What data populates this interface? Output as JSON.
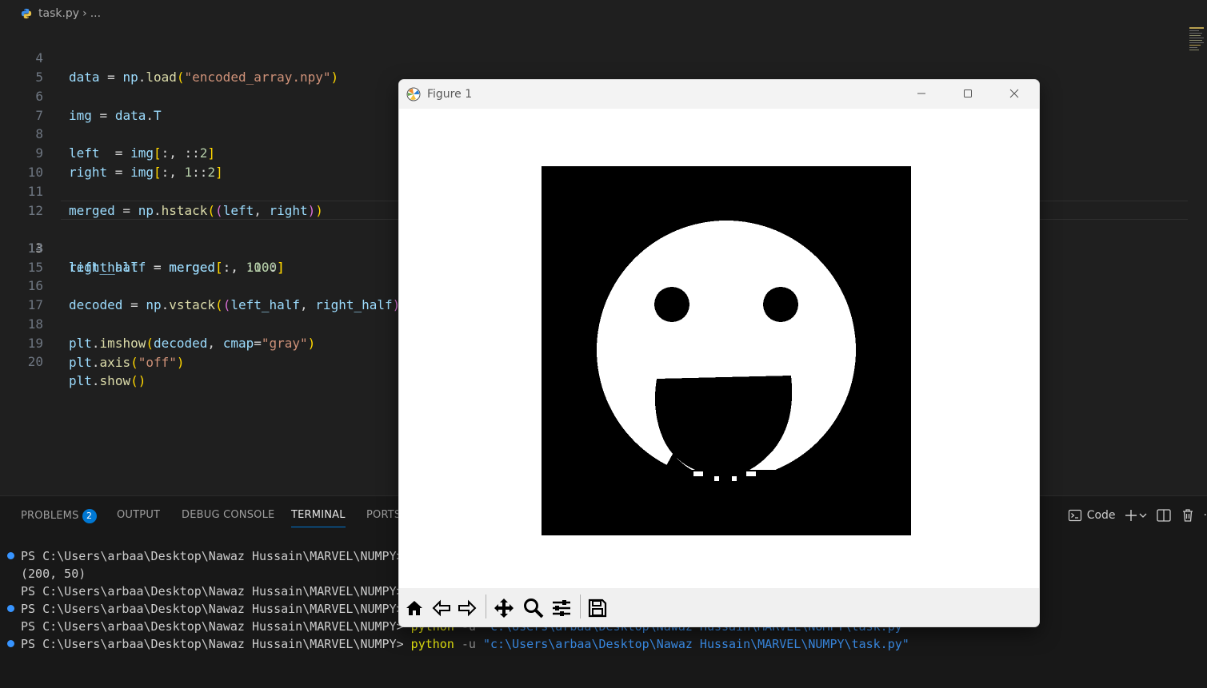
{
  "breadcrumb": {
    "file": "task.py",
    "more": "..."
  },
  "editor": {
    "active_line": "13",
    "lines": [
      {
        "n": "4",
        "t": "data = np.load(\"encoded_array.npy\")"
      },
      {
        "n": "5",
        "t": ""
      },
      {
        "n": "6",
        "t": "img = data.T"
      },
      {
        "n": "7",
        "t": ""
      },
      {
        "n": "8",
        "t": "left  = img[:, ::2]"
      },
      {
        "n": "9",
        "t": "right = img[:, 1::2]"
      },
      {
        "n": "10",
        "t": ""
      },
      {
        "n": "11",
        "t": "merged = np.hstack((left, right))"
      },
      {
        "n": "12",
        "t": ""
      },
      {
        "n": "13",
        "t": "left_half  = merged[:, :100]"
      },
      {
        "n": "14",
        "t": "right_half = merged[:, 100:]"
      },
      {
        "n": "15",
        "t": ""
      },
      {
        "n": "16",
        "t": "decoded = np.vstack((left_half, right_half)"
      },
      {
        "n": "17",
        "t": ""
      },
      {
        "n": "18",
        "t": "plt.imshow(decoded, cmap=\"gray\")"
      },
      {
        "n": "19",
        "t": "plt.axis(\"off\")"
      },
      {
        "n": "20",
        "t": "plt.show()"
      }
    ]
  },
  "panel": {
    "tabs": {
      "problems": "PROBLEMS",
      "problems_count": "2",
      "output": "OUTPUT",
      "debug": "DEBUG CONSOLE",
      "terminal": "TERMINAL",
      "ports": "PORTS"
    },
    "profile_label": "Code",
    "terminal": {
      "l1": "PS C:\\Users\\arbaa\\Desktop\\Nawaz Hussain\\MARVEL\\NUMPY>",
      "l2": "(200, 50)",
      "l3": "PS C:\\Users\\arbaa\\Desktop\\Nawaz Hussain\\MARVEL\\NUMPY>",
      "l4": "PS C:\\Users\\arbaa\\Desktop\\Nawaz Hussain\\MARVEL\\NUMPY>",
      "l5_prompt": "PS C:\\Users\\arbaa\\Desktop\\Nawaz Hussain\\MARVEL\\NUMPY>",
      "l5_cmd": "python",
      "l5_flag": "-u",
      "l5_path": "\"c:\\Users\\arbaa\\Desktop\\Nawaz Hussain\\MARVEL\\NUMPY\\task.py\"",
      "l6_prompt": "PS C:\\Users\\arbaa\\Desktop\\Nawaz Hussain\\MARVEL\\NUMPY>",
      "l6_cmd": "python",
      "l6_flag": "-u",
      "l6_path": "\"c:\\Users\\arbaa\\Desktop\\Nawaz Hussain\\MARVEL\\NUMPY\\task.py\""
    }
  },
  "figure": {
    "title": "Figure 1",
    "toolbar_icons": [
      "home-icon",
      "back-arrow-icon",
      "forward-arrow-icon",
      "pan-icon",
      "zoom-icon",
      "configure-subplots-icon",
      "save-icon"
    ]
  },
  "colors": {
    "accent": "#0078d4",
    "editor_bg": "#1f1f1f",
    "panel_bg": "#181818"
  }
}
